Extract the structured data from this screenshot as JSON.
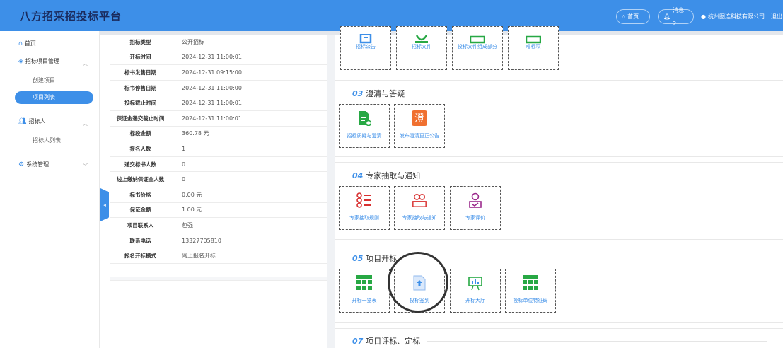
{
  "header": {
    "logo": "八方招采招投标平台",
    "home": "首页",
    "messages": "消息 2",
    "company": "杭州图连科技有限公司",
    "logout": "退出"
  },
  "sidebar": {
    "home": "首页",
    "project_mgmt": "招标项目管理",
    "create_project": "创建项目",
    "project_list": "项目列表",
    "tenderer": "招标人",
    "tenderer_list": "招标人列表",
    "system": "系统管理"
  },
  "info": [
    {
      "k": "招标类型",
      "v": "公开招标"
    },
    {
      "k": "开标时间",
      "v": "2024-12-31 11:00:01"
    },
    {
      "k": "标书发售日期",
      "v": "2024-12-31 09:15:00"
    },
    {
      "k": "标书停售日期",
      "v": "2024-12-31 11:00:00"
    },
    {
      "k": "投标截止时间",
      "v": "2024-12-31 11:00:01"
    },
    {
      "k": "保证金递交截止时间",
      "v": "2024-12-31 11:00:01"
    },
    {
      "k": "标段金额",
      "v": "360.78 元"
    },
    {
      "k": "报名人数",
      "v": "1"
    },
    {
      "k": "递交标书人数",
      "v": "0"
    },
    {
      "k": "线上缴纳保证金人数",
      "v": "0"
    },
    {
      "k": "标书价格",
      "v": "0.00 元"
    },
    {
      "k": "保证金额",
      "v": "1.00 元"
    },
    {
      "k": "项目联系人",
      "v": "包强"
    },
    {
      "k": "联系电话",
      "v": "13327705810"
    },
    {
      "k": "报名开标模式",
      "v": "网上报名开标"
    }
  ],
  "sec_top": {
    "cards": [
      "招标公告",
      "招标文件",
      "投标文件组成部分",
      "唱标项"
    ]
  },
  "sec03": {
    "num": "03",
    "title": "澄清与答疑",
    "cards": [
      "招标质疑与澄清",
      "发布澄清更正公告"
    ]
  },
  "sec04": {
    "num": "04",
    "title": "专家抽取与通知",
    "cards": [
      "专家抽取规则",
      "专家抽取与通知",
      "专家评价"
    ]
  },
  "sec05": {
    "num": "05",
    "title": "项目开标",
    "cards": [
      "开标一览表",
      "投标签到",
      "开标大厅",
      "投标单位特征码"
    ]
  },
  "sec07": {
    "num": "07",
    "title": "项目评标、定标"
  },
  "colors": {
    "accent": "#3d8fe8",
    "green": "#27a844",
    "orange": "#f07030",
    "red": "#d83030",
    "purple": "#9b2a8c"
  }
}
